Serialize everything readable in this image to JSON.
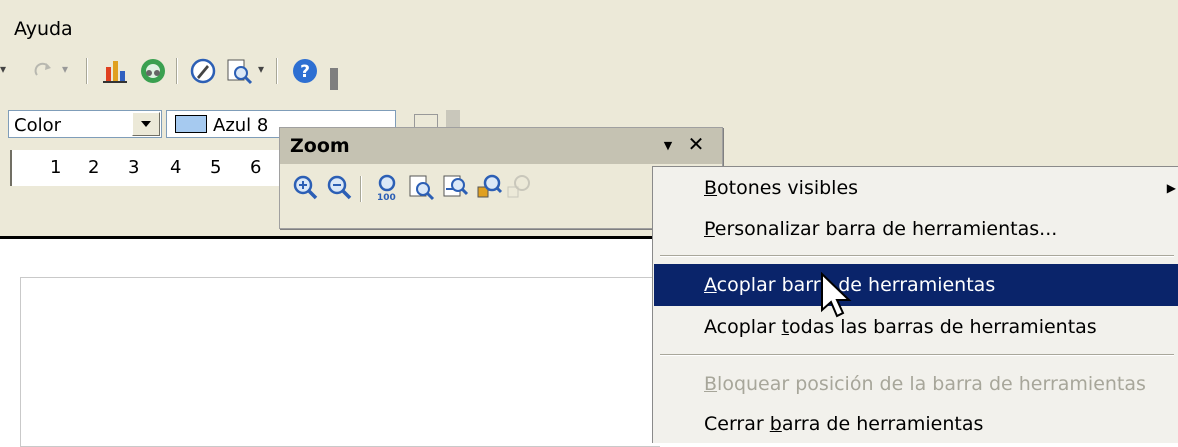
{
  "menubar": {
    "items": [
      {
        "label": "Ayuda"
      }
    ]
  },
  "toolbar_standard": {
    "icons": [
      "redo-icon",
      "chart-icon",
      "navigator-icon",
      "draw-icon",
      "zoom-icon",
      "help-icon",
      "overflow-icon"
    ]
  },
  "toolbar_format": {
    "line_color_label": "Color",
    "area_color_label": "Azul 8"
  },
  "ruler": {
    "numbers": [
      "1",
      "2",
      "3",
      "4",
      "5",
      "6"
    ]
  },
  "zoom_toolbar": {
    "title": "Zoom",
    "dropdown_glyph": "▼",
    "close_glyph": "✕",
    "icons": [
      "zoom-in-icon",
      "zoom-out-icon",
      "zoom-100-icon",
      "zoom-page-icon",
      "zoom-page-width-icon",
      "zoom-optimal-icon",
      "zoom-selection-icon"
    ]
  },
  "context_menu": {
    "items": [
      {
        "pre": "",
        "u": "B",
        "post": "otones visibles",
        "state": "normal",
        "has_submenu": true
      },
      {
        "pre": "",
        "u": "P",
        "post": "ersonalizar barra de herramientas...",
        "state": "normal",
        "has_submenu": false
      },
      {
        "pre": "",
        "u": "A",
        "post": "coplar barra de herramientas",
        "state": "selected",
        "has_submenu": false
      },
      {
        "pre": "Acoplar ",
        "u": "t",
        "post": "odas las barras de herramientas",
        "state": "normal",
        "has_submenu": false
      },
      {
        "pre": "",
        "u": "B",
        "post": "loquear posición de la barra de herramientas",
        "state": "disabled",
        "has_submenu": false
      },
      {
        "pre": "Cerrar ",
        "u": "b",
        "post": "arra de herramientas",
        "state": "normal",
        "has_submenu": false
      }
    ],
    "submenu_arrow": "▶"
  },
  "colors": {
    "menu_highlight": "#0a246a",
    "chrome": "#ece9d8",
    "swatch": "#a6caf0",
    "disabled_text": "#a7a69a"
  }
}
